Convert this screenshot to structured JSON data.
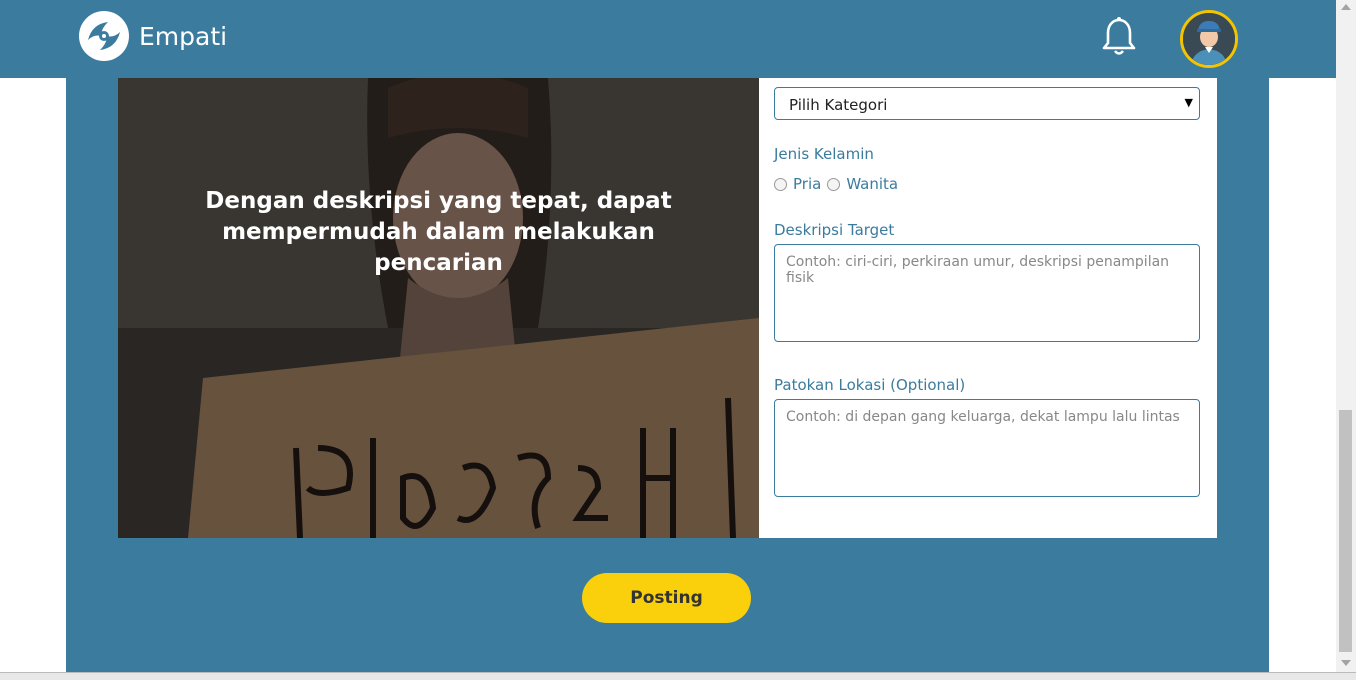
{
  "app": {
    "name": "Empati"
  },
  "header": {
    "brand": "Empati"
  },
  "hero": {
    "caption": "Dengan deskripsi yang tepat, dapat mempermudah dalam melakukan pencarian",
    "sign_text": "Please,H"
  },
  "form": {
    "category_select": {
      "value": "Pilih Kategori"
    },
    "gender": {
      "label": "Jenis Kelamin",
      "options": [
        "Pria",
        "Wanita"
      ]
    },
    "description": {
      "label": "Deskripsi Target",
      "placeholder": "Contoh: ciri-ciri, perkiraan umur, deskripsi penampilan fisik"
    },
    "location": {
      "label": "Patokan Lokasi (Optional)",
      "placeholder": "Contoh: di depan gang keluarga, dekat lampu lalu lintas"
    }
  },
  "actions": {
    "post_label": "Posting"
  },
  "colors": {
    "primary": "#3b7c9e",
    "accent": "#f9d00b",
    "white": "#ffffff"
  },
  "icons": {
    "brand_logo": "hands-heart-logo",
    "notifications": "bell-icon",
    "profile": "avatar"
  }
}
